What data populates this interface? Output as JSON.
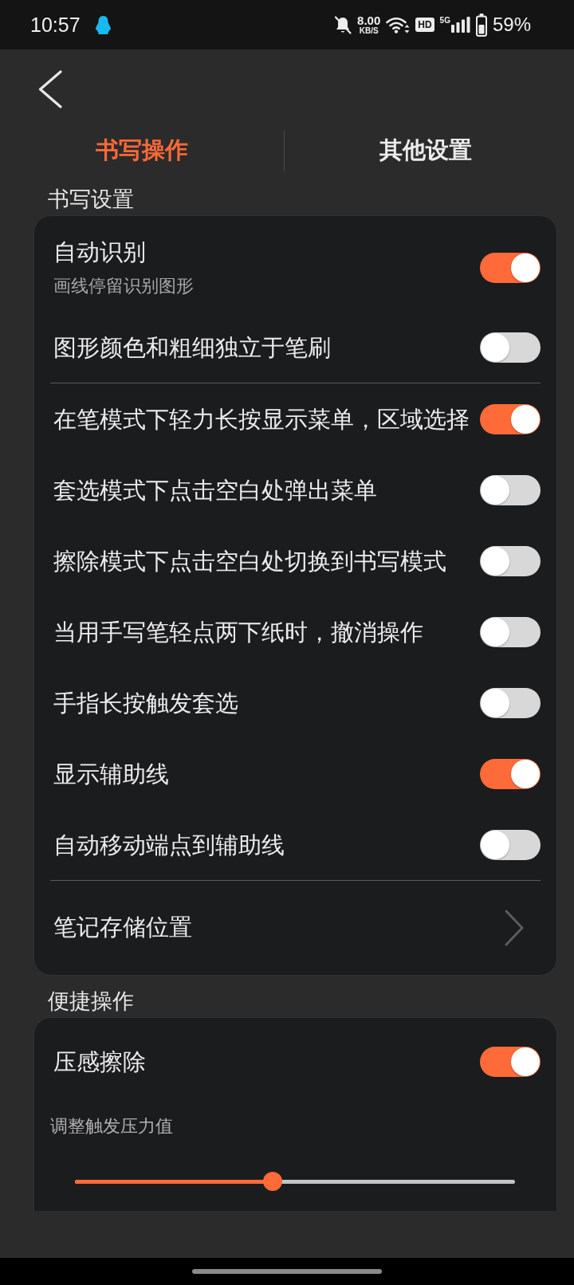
{
  "status_bar": {
    "time": "10:57",
    "network_speed": "8.00",
    "network_speed_unit": "KB/S",
    "hd": "HD",
    "network_type": "5G",
    "battery": "59%"
  },
  "tabs": [
    {
      "label": "书写操作",
      "selected": true
    },
    {
      "label": "其他设置",
      "selected": false
    }
  ],
  "sections": [
    {
      "title": "书写设置",
      "groups": [
        {
          "items": [
            {
              "kind": "toggle",
              "title": "自动识别",
              "subtitle": "画线停留识别图形",
              "on": true
            },
            {
              "kind": "toggle",
              "title": "图形颜色和粗细独立于笔刷",
              "on": false
            }
          ]
        },
        {
          "items": [
            {
              "kind": "toggle",
              "title": "在笔模式下轻力长按显示菜单，区域选择",
              "on": true
            },
            {
              "kind": "toggle",
              "title": "套选模式下点击空白处弹出菜单",
              "on": false
            },
            {
              "kind": "toggle",
              "title": "擦除模式下点击空白处切换到书写模式",
              "on": false
            },
            {
              "kind": "toggle",
              "title": "当用手写笔轻点两下纸时，撤消操作",
              "on": false
            },
            {
              "kind": "toggle",
              "title": "手指长按触发套选",
              "on": false
            },
            {
              "kind": "toggle",
              "title": "显示辅助线",
              "on": true
            },
            {
              "kind": "toggle",
              "title": "自动移动端点到辅助线",
              "on": false
            }
          ]
        },
        {
          "items": [
            {
              "kind": "link",
              "title": "笔记存储位置"
            }
          ]
        }
      ]
    },
    {
      "title": "便捷操作",
      "groups": [
        {
          "items": [
            {
              "kind": "toggle",
              "title": "压感擦除",
              "on": true
            },
            {
              "kind": "slider",
              "title": "调整触发压力值",
              "level": 0.45
            }
          ]
        }
      ]
    }
  ]
}
